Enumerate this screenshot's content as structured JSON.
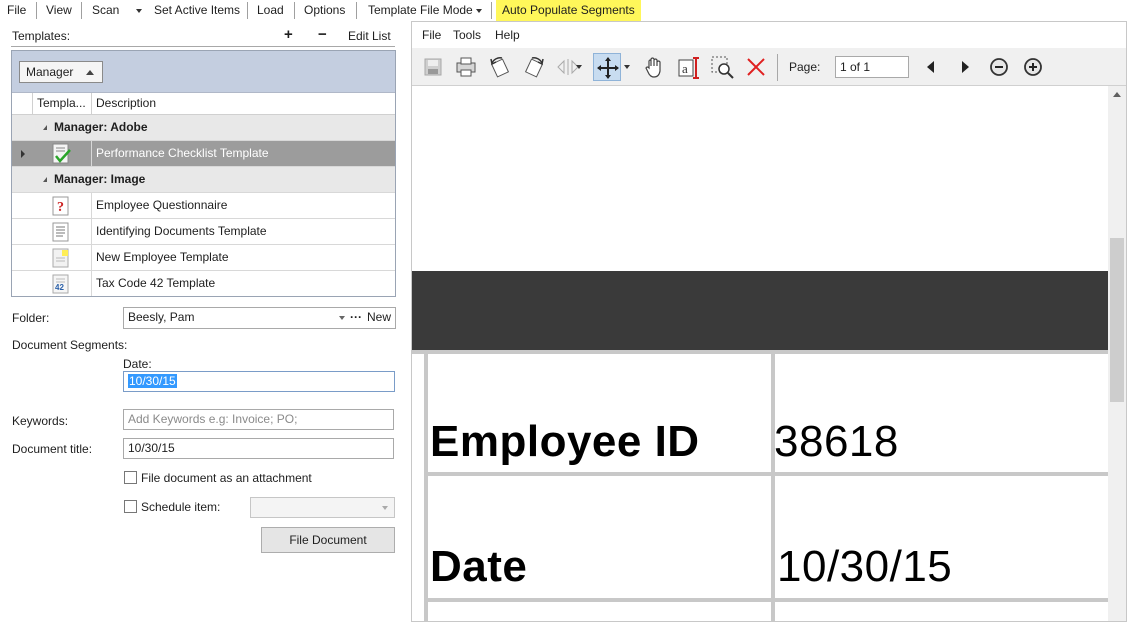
{
  "menubar": {
    "file": "File",
    "view": "View",
    "scan": "Scan",
    "set_active_items": "Set Active Items",
    "load": "Load",
    "options": "Options",
    "template_file_mode": "Template File Mode",
    "auto_populate": "Auto Populate Segments"
  },
  "templates": {
    "label": "Templates:",
    "add": "+",
    "remove": "−",
    "edit_list": "Edit List",
    "group_by": "Manager",
    "columns": [
      "Templa...",
      "Description"
    ],
    "groups": [
      {
        "title": "Manager: Adobe",
        "rows": [
          {
            "icon": "checklist-icon",
            "description": "Performance Checklist Template",
            "selected": true
          }
        ]
      },
      {
        "title": "Manager: Image",
        "rows": [
          {
            "icon": "question-icon",
            "description": "Employee Questionnaire"
          },
          {
            "icon": "document-lines-icon",
            "description": "Identifying Documents Template"
          },
          {
            "icon": "note-icon",
            "description": "New Employee Template"
          },
          {
            "icon": "tax-form-icon",
            "description": "Tax Code 42 Template",
            "badge": "42"
          }
        ]
      }
    ]
  },
  "folder": {
    "label": "Folder:",
    "value": "Beesly, Pam",
    "more": "···",
    "new": "New"
  },
  "segments": {
    "label": "Document Segments:",
    "date_label": "Date:",
    "date_value": "10/30/15"
  },
  "keywords": {
    "label": "Keywords:",
    "placeholder": "Add Keywords e.g: Invoice; PO;"
  },
  "title_field": {
    "label": "Document title:",
    "value": "10/30/15"
  },
  "attach": {
    "label": "File document as an attachment",
    "checked": false
  },
  "schedule": {
    "label": "Schedule item:",
    "checked": false,
    "value": ""
  },
  "file_button": "File Document",
  "viewer": {
    "menu": {
      "file": "File",
      "tools": "Tools",
      "help": "Help"
    },
    "page_label": "Page:",
    "page_value": "1 of 1",
    "doc": {
      "row1_label": "Employee ID",
      "row1_value": "38618",
      "row2_label": "Date",
      "row2_value": "10/30/15"
    }
  },
  "colors": {
    "highlight": "#fff75a",
    "selected_row": "#9c9c9c",
    "group_zone": "#c4cee0",
    "dark_band": "#3a3a3a",
    "delete_red": "#e02020"
  }
}
